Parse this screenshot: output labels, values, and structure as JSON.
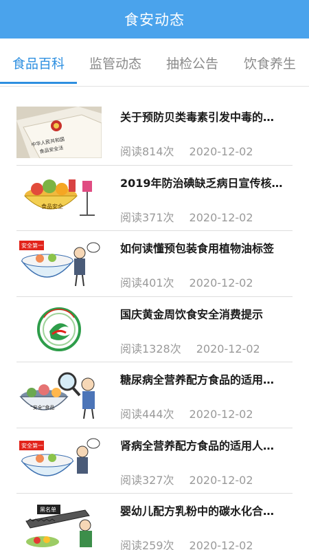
{
  "header": {
    "title": "食安动态"
  },
  "tabs": [
    {
      "label": "食品百科"
    },
    {
      "label": "监管动态"
    },
    {
      "label": "抽检公告"
    },
    {
      "label": "饮食养生"
    }
  ],
  "articles": [
    {
      "title": "关于预防贝类毒素引发中毒的…",
      "reads": "阅读814次",
      "date": "2020-12-02",
      "thumb_icon": "food-safety-law-book-image",
      "thumb_text": "中华人民共和国 食品安全法"
    },
    {
      "title": "2019年防治碘缺乏病日宣传核…",
      "reads": "阅读371次",
      "date": "2020-12-02",
      "thumb_icon": "food-safety-bowl-image",
      "thumb_text": "食品安全"
    },
    {
      "title": "如何读懂预包装食用植物油标签",
      "reads": "阅读401次",
      "date": "2020-12-02",
      "thumb_icon": "safety-first-cartoon-image",
      "thumb_text": "安全第一"
    },
    {
      "title": "国庆黄金周饮食安全消费提示",
      "reads": "阅读1328次",
      "date": "2020-12-02",
      "thumb_icon": "food-security-logo-image",
      "thumb_text": ""
    },
    {
      "title": "糖尿病全营养配方食品的适用…",
      "reads": "阅读444次",
      "date": "2020-12-02",
      "thumb_icon": "magnifier-inspection-cartoon-image",
      "thumb_text": "“安全”食品"
    },
    {
      "title": "肾病全营养配方食品的适用人…",
      "reads": "阅读327次",
      "date": "2020-12-02",
      "thumb_icon": "safety-first-cartoon-image",
      "thumb_text": "安全第一"
    },
    {
      "title": "婴幼儿配方乳粉中的碳水化合…",
      "reads": "阅读259次",
      "date": "2020-12-02",
      "thumb_icon": "blacklist-chainsaw-cartoon-image",
      "thumb_text": "黑名单"
    }
  ],
  "colors": {
    "appbar": "#4aa3ec",
    "accent": "#2d8fe0",
    "muted": "#9a9a9a",
    "red": "#e2231a"
  }
}
